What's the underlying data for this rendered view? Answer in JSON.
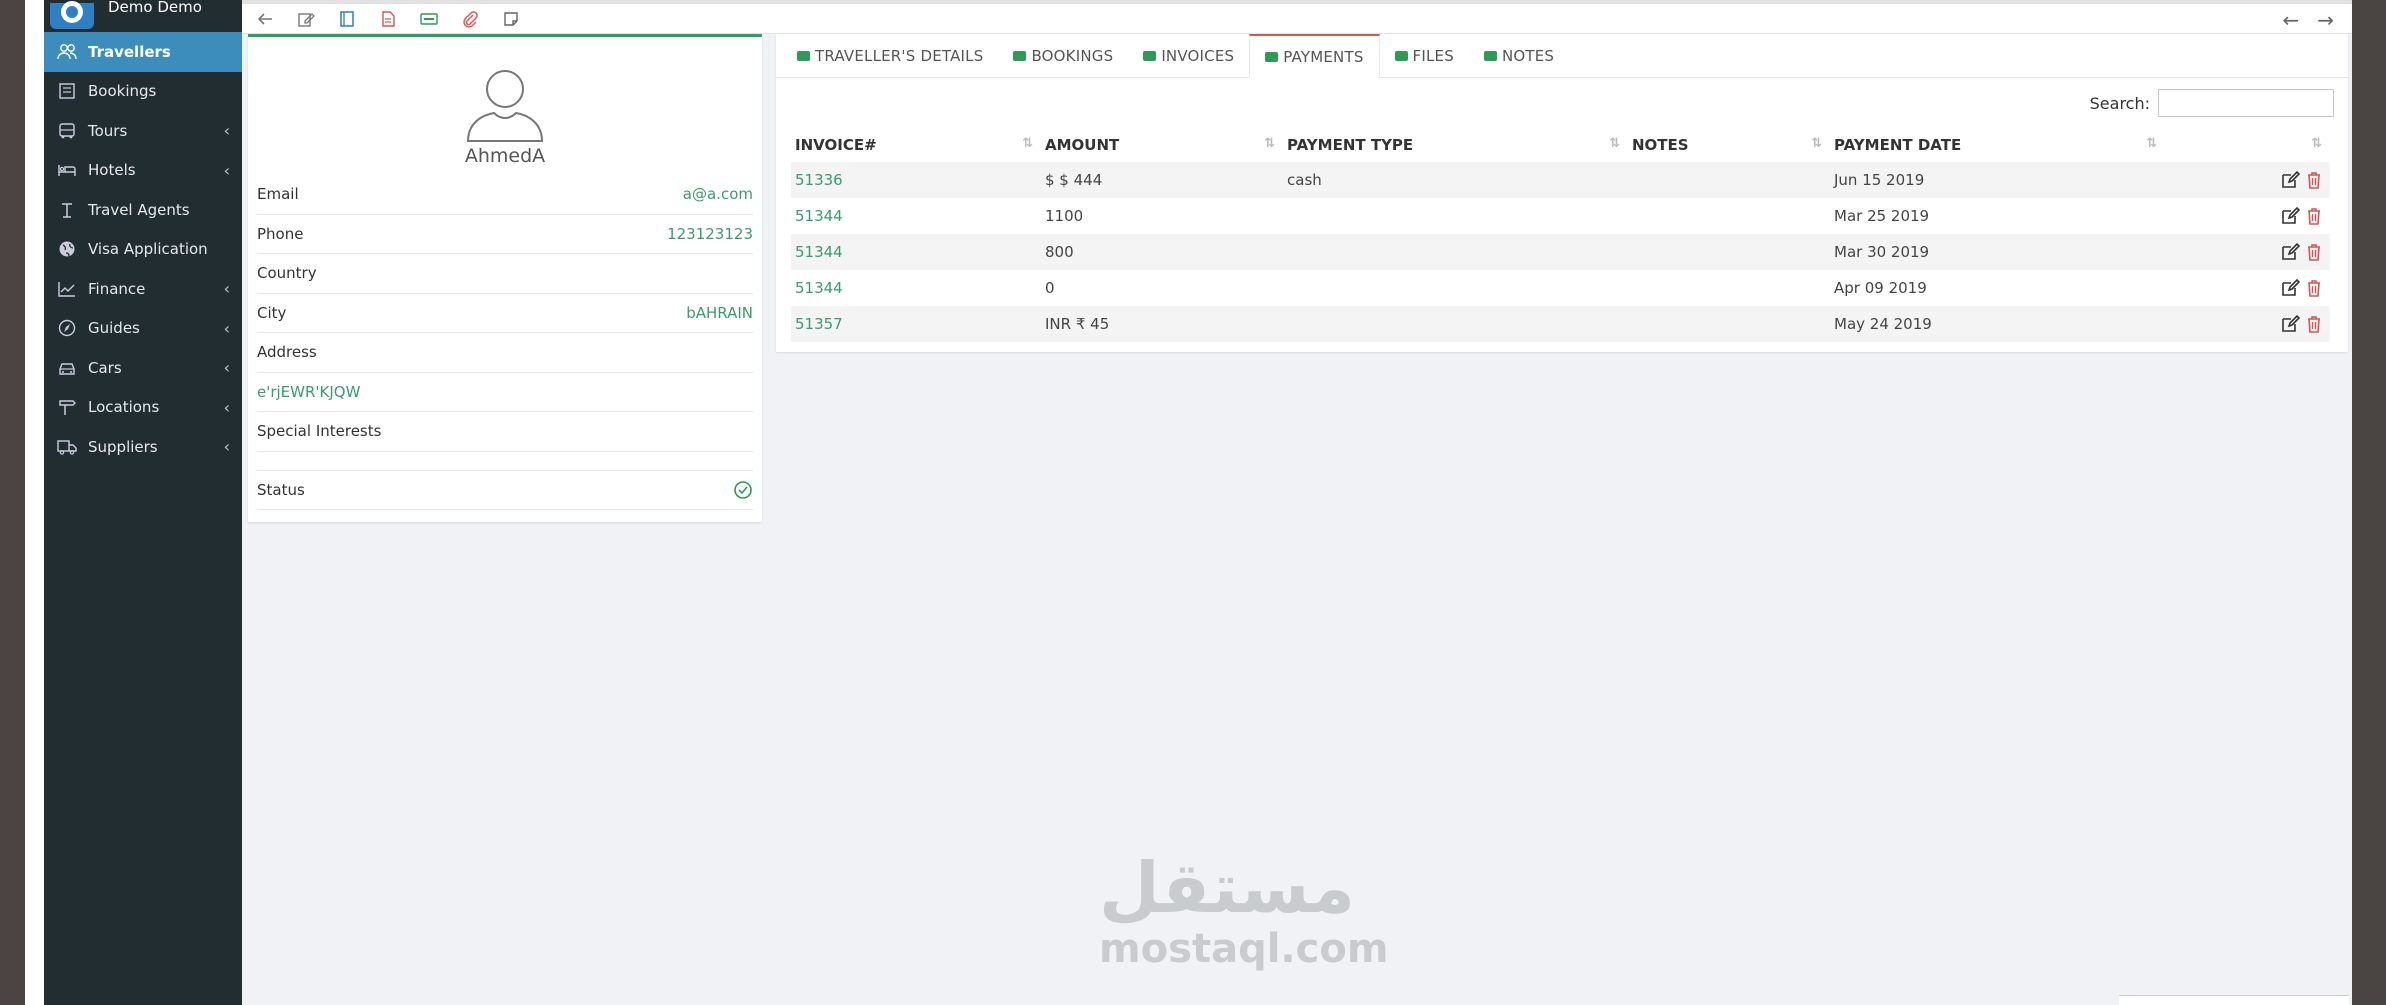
{
  "brand": {
    "name": "Demo Demo"
  },
  "sidebar": {
    "items": [
      {
        "label": "Travellers",
        "icon": "users-icon",
        "active": true,
        "chevron": false
      },
      {
        "label": "Bookings",
        "icon": "bookings-icon",
        "chevron": false
      },
      {
        "label": "Tours",
        "icon": "bus-icon",
        "chevron": true
      },
      {
        "label": "Hotels",
        "icon": "bed-icon",
        "chevron": true
      },
      {
        "label": "Travel Agents",
        "icon": "agent-icon",
        "chevron": false
      },
      {
        "label": "Visa Application",
        "icon": "globe-icon",
        "chevron": false
      },
      {
        "label": "Finance",
        "icon": "chart-icon",
        "chevron": true
      },
      {
        "label": "Guides",
        "icon": "compass-icon",
        "chevron": true
      },
      {
        "label": "Cars",
        "icon": "car-icon",
        "chevron": true
      },
      {
        "label": "Locations",
        "icon": "signpost-icon",
        "chevron": true
      },
      {
        "label": "Suppliers",
        "icon": "truck-icon",
        "chevron": true
      }
    ],
    "chevron_glyph": "‹"
  },
  "toolbar": {
    "back_glyph": "←",
    "prev_glyph": "←",
    "next_glyph": "→"
  },
  "profile": {
    "name": "AhmedA",
    "email_label": "Email",
    "email": "a@a.com",
    "phone_label": "Phone",
    "phone": "123123123",
    "country_label": "Country",
    "country": "",
    "city_label": "City",
    "city": "bAHRAIN",
    "address_label": "Address",
    "address": "e'rjEWR'KJQW",
    "interests_label": "Special Interests",
    "status_label": "Status"
  },
  "tabs": [
    {
      "label": "TRAVELLER'S DETAILS"
    },
    {
      "label": "BOOKINGS"
    },
    {
      "label": "INVOICES"
    },
    {
      "label": "PAYMENTS",
      "active": true
    },
    {
      "label": "FILES"
    },
    {
      "label": "NOTES"
    }
  ],
  "search": {
    "label": "Search:",
    "value": ""
  },
  "payments": {
    "headers": [
      "INVOICE#",
      "AMOUNT",
      "PAYMENT TYPE",
      "NOTES",
      "PAYMENT DATE",
      ""
    ],
    "sort_glyph": "⇅",
    "rows": [
      {
        "invoice": "51336",
        "amount": "$ $ 444",
        "type": "cash",
        "notes": "",
        "date": "Jun 15 2019"
      },
      {
        "invoice": "51344",
        "amount": "1100",
        "type": "",
        "notes": "",
        "date": "Mar 25 2019"
      },
      {
        "invoice": "51344",
        "amount": "800",
        "type": "",
        "notes": "",
        "date": "Mar 30 2019"
      },
      {
        "invoice": "51344",
        "amount": "0",
        "type": "",
        "notes": "",
        "date": "Apr 09 2019"
      },
      {
        "invoice": "51357",
        "amount": "INR ₹ 45",
        "type": "",
        "notes": "",
        "date": "May 24 2019"
      }
    ]
  },
  "watermark": {
    "arabic": "مستقل",
    "latin": "mostaql.com"
  },
  "colors": {
    "sidebar": "#222d32",
    "active": "#3c8dbc",
    "accent_green": "#3a9c6e",
    "danger": "#d9534f"
  }
}
